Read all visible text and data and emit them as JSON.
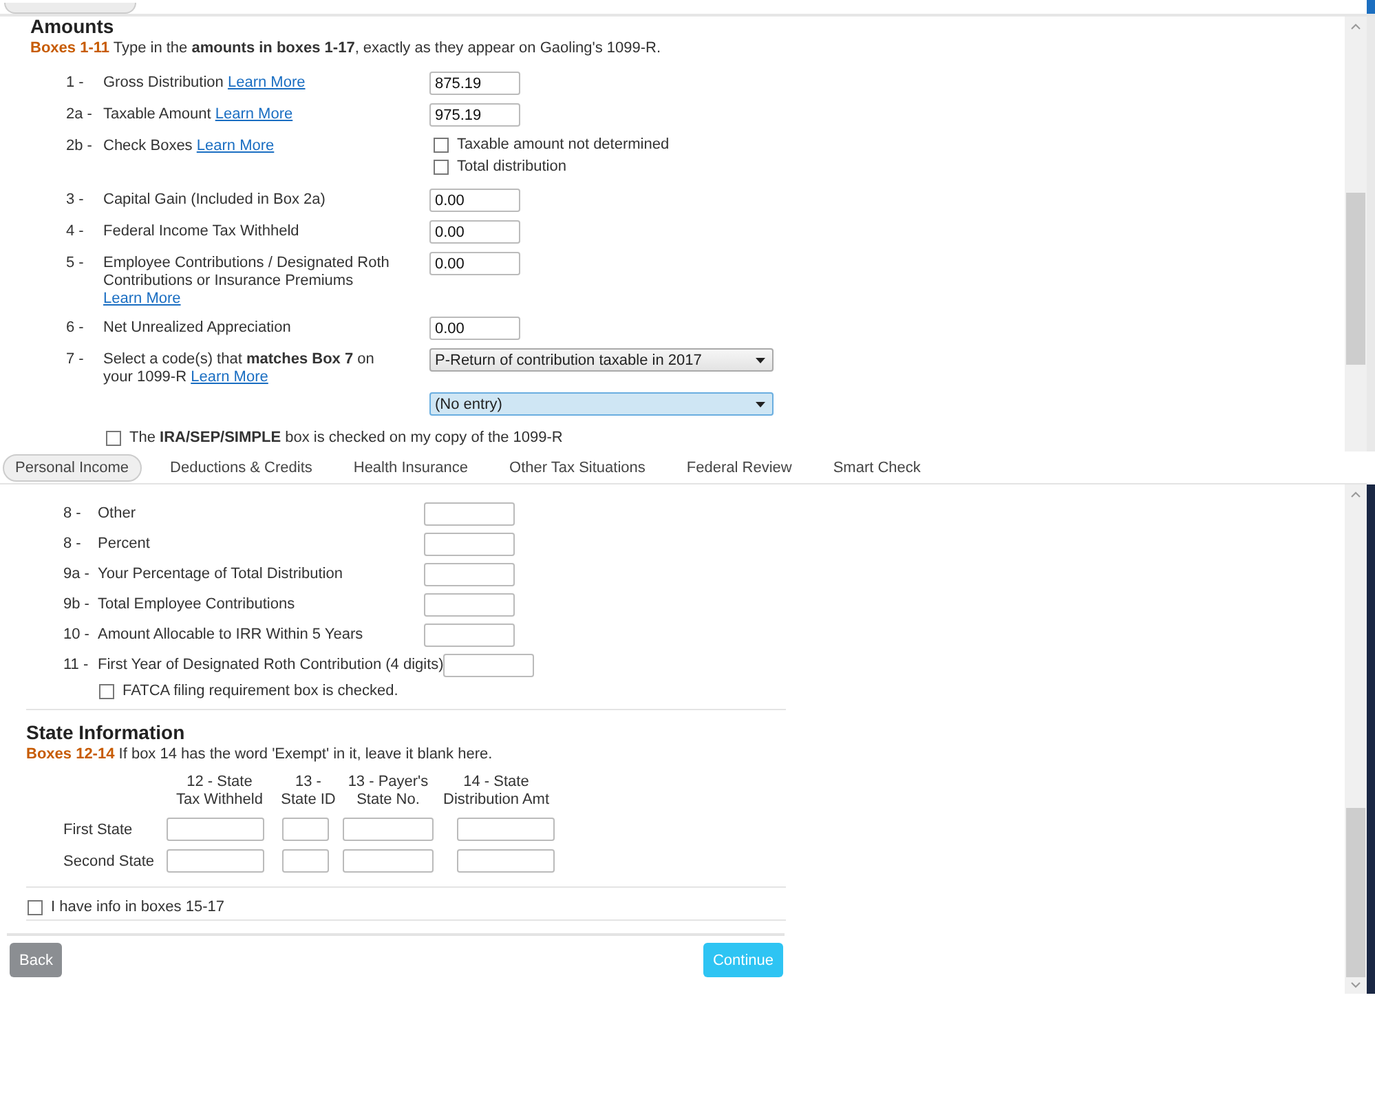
{
  "top_panel": {
    "heading": "Amounts",
    "intro": {
      "tag": "Boxes 1-11",
      "text": "Type in the **amounts in boxes 1-17**, exactly as they appear on Gaoling's 1099-R."
    },
    "rows": [
      {
        "kind": "input",
        "number": "1 -",
        "label": "Gross Distribution",
        "link": "Learn More",
        "value": "875.19"
      },
      {
        "kind": "input",
        "number": "2a -",
        "label": "Taxable Amount",
        "link": "Learn More",
        "value": "975.19"
      },
      {
        "kind": "checkboxes",
        "number": "2b -",
        "label": "Check Boxes",
        "link": "Learn More",
        "options": [
          {
            "label": "Taxable amount not determined",
            "checked": false
          },
          {
            "label": "Total distribution",
            "checked": false
          }
        ]
      },
      {
        "kind": "input",
        "number": "3 -",
        "label": "Capital Gain (Included in Box 2a)",
        "value": "0.00"
      },
      {
        "kind": "input",
        "number": "4 -",
        "label": "Federal Income Tax Withheld",
        "value": "0.00"
      },
      {
        "kind": "input",
        "number": "5 -",
        "label": "Employee Contributions / Designated Roth Contributions or Insurance Premiums",
        "link": "Learn More",
        "value": "0.00"
      },
      {
        "kind": "input",
        "number": "6 -",
        "label": "Net Unrealized Appreciation",
        "value": "0.00"
      },
      {
        "kind": "select",
        "number": "7 -",
        "label": "Select a code(s) that **matches Box 7** on your 1099-R",
        "link": "Learn More",
        "selects": [
          {
            "value": "P-Return of contribution taxable in 2017",
            "focused": false
          },
          {
            "value": "(No entry)",
            "focused": true
          }
        ]
      }
    ],
    "ira_checkbox": {
      "label": "The **IRA/SEP/SIMPLE** box is checked on my copy of the 1099-R",
      "checked": false
    }
  },
  "tabs": [
    {
      "label": "Personal Income",
      "selected": true
    },
    {
      "label": "Deductions & Credits",
      "selected": false
    },
    {
      "label": "Health Insurance",
      "selected": false
    },
    {
      "label": "Other Tax Situations",
      "selected": false
    },
    {
      "label": "Federal Review",
      "selected": false
    },
    {
      "label": "Smart Check",
      "selected": false
    }
  ],
  "bottom_panel": {
    "rows": [
      {
        "number": "8 -",
        "label": "Other"
      },
      {
        "number": "8 -",
        "label": "Percent"
      },
      {
        "number": "9a -",
        "label": "Your Percentage of Total Distribution"
      },
      {
        "number": "9b -",
        "label": "Total Employee Contributions"
      },
      {
        "number": "10 -",
        "label": "Amount Allocable to IRR Within 5 Years"
      },
      {
        "number": "11 -",
        "label": "First Year of Designated Roth Contribution (4 digits)"
      }
    ],
    "fatca_checkbox": {
      "label": "FATCA filing requirement box is checked.",
      "checked": false
    },
    "state": {
      "heading": "State Information",
      "intro": {
        "tag": "Boxes 12-14",
        "text": "If box 14 has the word 'Exempt' in it, leave it blank here."
      },
      "columns": [
        "12 - State\nTax Withheld",
        "13 -\nState ID",
        "13 - Payer's\nState No.",
        "14 - State\nDistribution Amt"
      ],
      "rows": [
        {
          "label": "First State"
        },
        {
          "label": "Second State"
        }
      ]
    },
    "boxes_checkbox": {
      "label": "I have info in boxes 15-17",
      "checked": false
    },
    "buttons": {
      "back": "Back",
      "continue": "Continue"
    }
  }
}
